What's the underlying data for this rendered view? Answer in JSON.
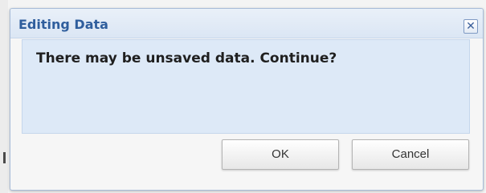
{
  "dialog": {
    "title": "Editing Data",
    "close_glyph": "✕",
    "message": "There may be unsaved data. Continue?",
    "buttons": {
      "ok_label": "OK",
      "cancel_label": "Cancel"
    }
  },
  "icons": {
    "close": "close-icon"
  },
  "colors": {
    "title_text": "#2f5e9d",
    "titlebar_bg": "#dbe6f4",
    "content_bg": "#dde9f7",
    "dialog_border": "#a8bcd8"
  }
}
